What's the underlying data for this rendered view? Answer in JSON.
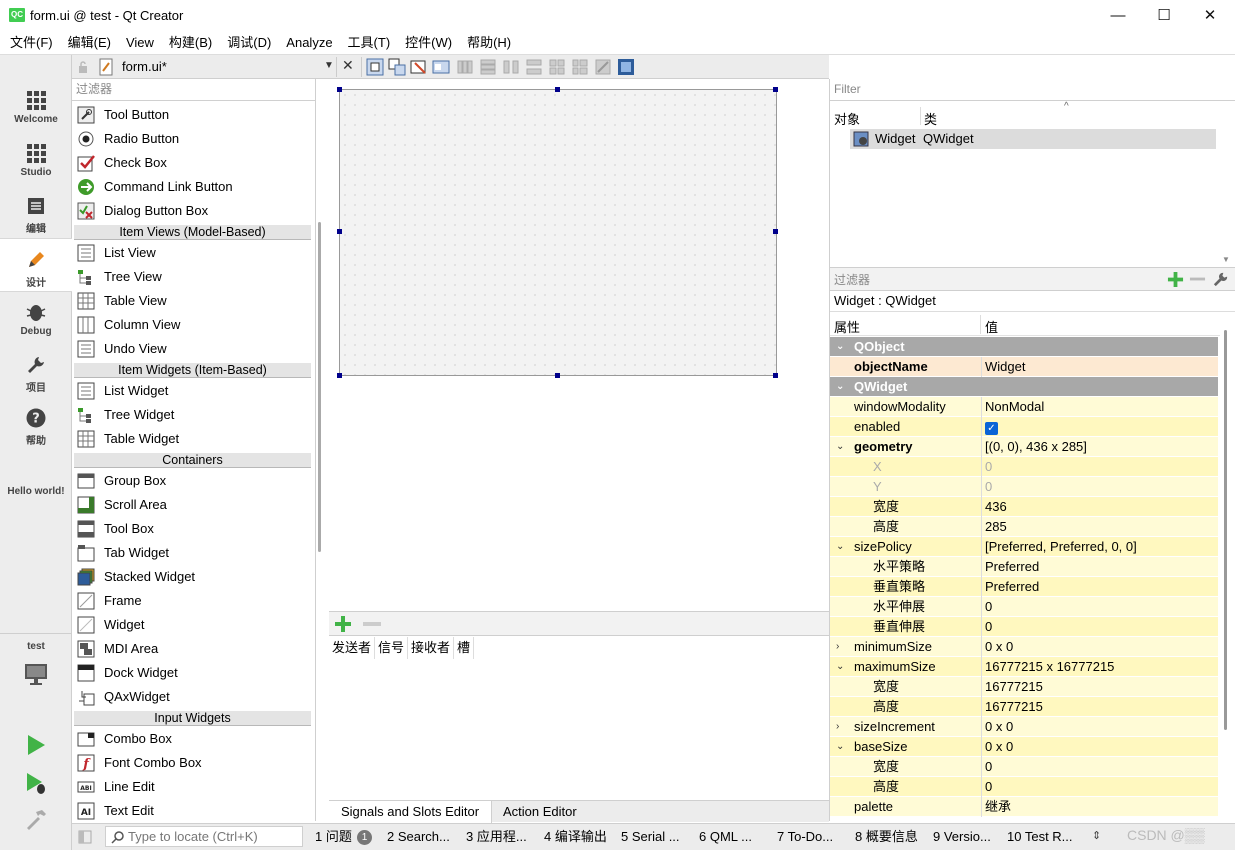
{
  "window": {
    "title": "form.ui @ test - Qt Creator",
    "logo": "QC",
    "minimize": "—",
    "maximize": "☐",
    "close": "✕"
  },
  "menu": [
    "文件(F)",
    "编辑(E)",
    "View",
    "构建(B)",
    "调试(D)",
    "Analyze",
    "工具(T)",
    "控件(W)",
    "帮助(H)"
  ],
  "modes": [
    {
      "label": "Welcome",
      "icon": "grid-icon"
    },
    {
      "label": "Studio",
      "icon": "grid-icon"
    },
    {
      "label": "编辑",
      "icon": "document-icon"
    },
    {
      "label": "设计",
      "icon": "pencil-icon",
      "active": true
    },
    {
      "label": "Debug",
      "icon": "bug-icon"
    },
    {
      "label": "项目",
      "icon": "wrench-icon"
    },
    {
      "label": "帮助",
      "icon": "help-icon"
    }
  ],
  "mode_extra": {
    "hello": "Hello world!",
    "project": "test"
  },
  "editor": {
    "file_name": "form.ui*"
  },
  "widget_box": {
    "filter_placeholder": "过滤器",
    "items_top": [
      "Tool Button",
      "Radio Button",
      "Check Box",
      "Command Link Button",
      "Dialog Button Box"
    ],
    "cat_item_views": "Item Views (Model-Based)",
    "item_views": [
      "List View",
      "Tree View",
      "Table View",
      "Column View",
      "Undo View"
    ],
    "cat_item_widgets": "Item Widgets (Item-Based)",
    "item_widgets": [
      "List Widget",
      "Tree Widget",
      "Table Widget"
    ],
    "cat_containers": "Containers",
    "containers": [
      "Group Box",
      "Scroll Area",
      "Tool Box",
      "Tab Widget",
      "Stacked Widget",
      "Frame",
      "Widget",
      "MDI Area",
      "Dock Widget",
      "QAxWidget"
    ],
    "cat_input": "Input Widgets",
    "inputs": [
      "Combo Box",
      "Font Combo Box",
      "Line Edit",
      "Text Edit"
    ]
  },
  "signals_slots": {
    "columns": [
      "发送者",
      "信号",
      "接收者",
      "槽"
    ],
    "tabs": [
      "Signals and Slots Editor",
      "Action Editor"
    ]
  },
  "object_inspector": {
    "filter_placeholder": "Filter",
    "col_object": "对象",
    "col_class": "类",
    "row_object": "Widget",
    "row_class": "QWidget"
  },
  "property_editor": {
    "filter_placeholder": "过滤器",
    "class_label": "Widget : QWidget",
    "col_property": "属性",
    "col_value": "值",
    "rows": [
      {
        "name": "QObject",
        "value": "",
        "type": "sec"
      },
      {
        "name": "objectName",
        "value": "Widget",
        "type": "obj"
      },
      {
        "name": "QWidget",
        "value": "",
        "type": "sec"
      },
      {
        "name": "windowModality",
        "value": "NonModal",
        "type": "y1"
      },
      {
        "name": "enabled",
        "value": "checkbox-checked",
        "type": "y2"
      },
      {
        "name": "geometry",
        "value": "[(0, 0), 436 x 285]",
        "type": "y1",
        "arrow": "expanded",
        "bold": true
      },
      {
        "name": "X",
        "value": "0",
        "type": "y2",
        "sub": true,
        "dis": true
      },
      {
        "name": "Y",
        "value": "0",
        "type": "y1",
        "sub": true,
        "dis": true
      },
      {
        "name": "宽度",
        "value": "436",
        "type": "y2",
        "sub": true
      },
      {
        "name": "高度",
        "value": "285",
        "type": "y1",
        "sub": true
      },
      {
        "name": "sizePolicy",
        "value": "[Preferred, Preferred, 0, 0]",
        "type": "y2",
        "arrow": "expanded"
      },
      {
        "name": "水平策略",
        "value": "Preferred",
        "type": "y1",
        "sub": true
      },
      {
        "name": "垂直策略",
        "value": "Preferred",
        "type": "y2",
        "sub": true
      },
      {
        "name": "水平伸展",
        "value": "0",
        "type": "y1",
        "sub": true
      },
      {
        "name": "垂直伸展",
        "value": "0",
        "type": "y2",
        "sub": true
      },
      {
        "name": "minimumSize",
        "value": "0 x 0",
        "type": "y1",
        "arrow": "collapsed"
      },
      {
        "name": "maximumSize",
        "value": "16777215 x 16777215",
        "type": "y2",
        "arrow": "expanded"
      },
      {
        "name": "宽度",
        "value": "16777215",
        "type": "y1",
        "sub": true
      },
      {
        "name": "高度",
        "value": "16777215",
        "type": "y2",
        "sub": true
      },
      {
        "name": "sizeIncrement",
        "value": "0 x 0",
        "type": "y1",
        "arrow": "collapsed"
      },
      {
        "name": "baseSize",
        "value": "0 x 0",
        "type": "y2",
        "arrow": "expanded"
      },
      {
        "name": "宽度",
        "value": "0",
        "type": "y1",
        "sub": true
      },
      {
        "name": "高度",
        "value": "0",
        "type": "y2",
        "sub": true
      },
      {
        "name": "palette",
        "value": "继承",
        "type": "y1"
      }
    ]
  },
  "status": {
    "locate_placeholder": "Type to locate (Ctrl+K)",
    "panes": [
      "1 问题",
      "2 Search...",
      "3 应用程...",
      "4 编译输出",
      "5 Serial ...",
      "6 QML ...",
      "7 To-Do...",
      "8 概要信息",
      "9 Versio...",
      "10 Test R..."
    ],
    "problems_badge": "1",
    "watermark": "CSDN @▒▒"
  },
  "colors": {
    "accent_green": "#41cd52",
    "selection_handle": "#00008b",
    "property_yellow": "#fffbd6",
    "section_gray": "#a8a8a8"
  }
}
